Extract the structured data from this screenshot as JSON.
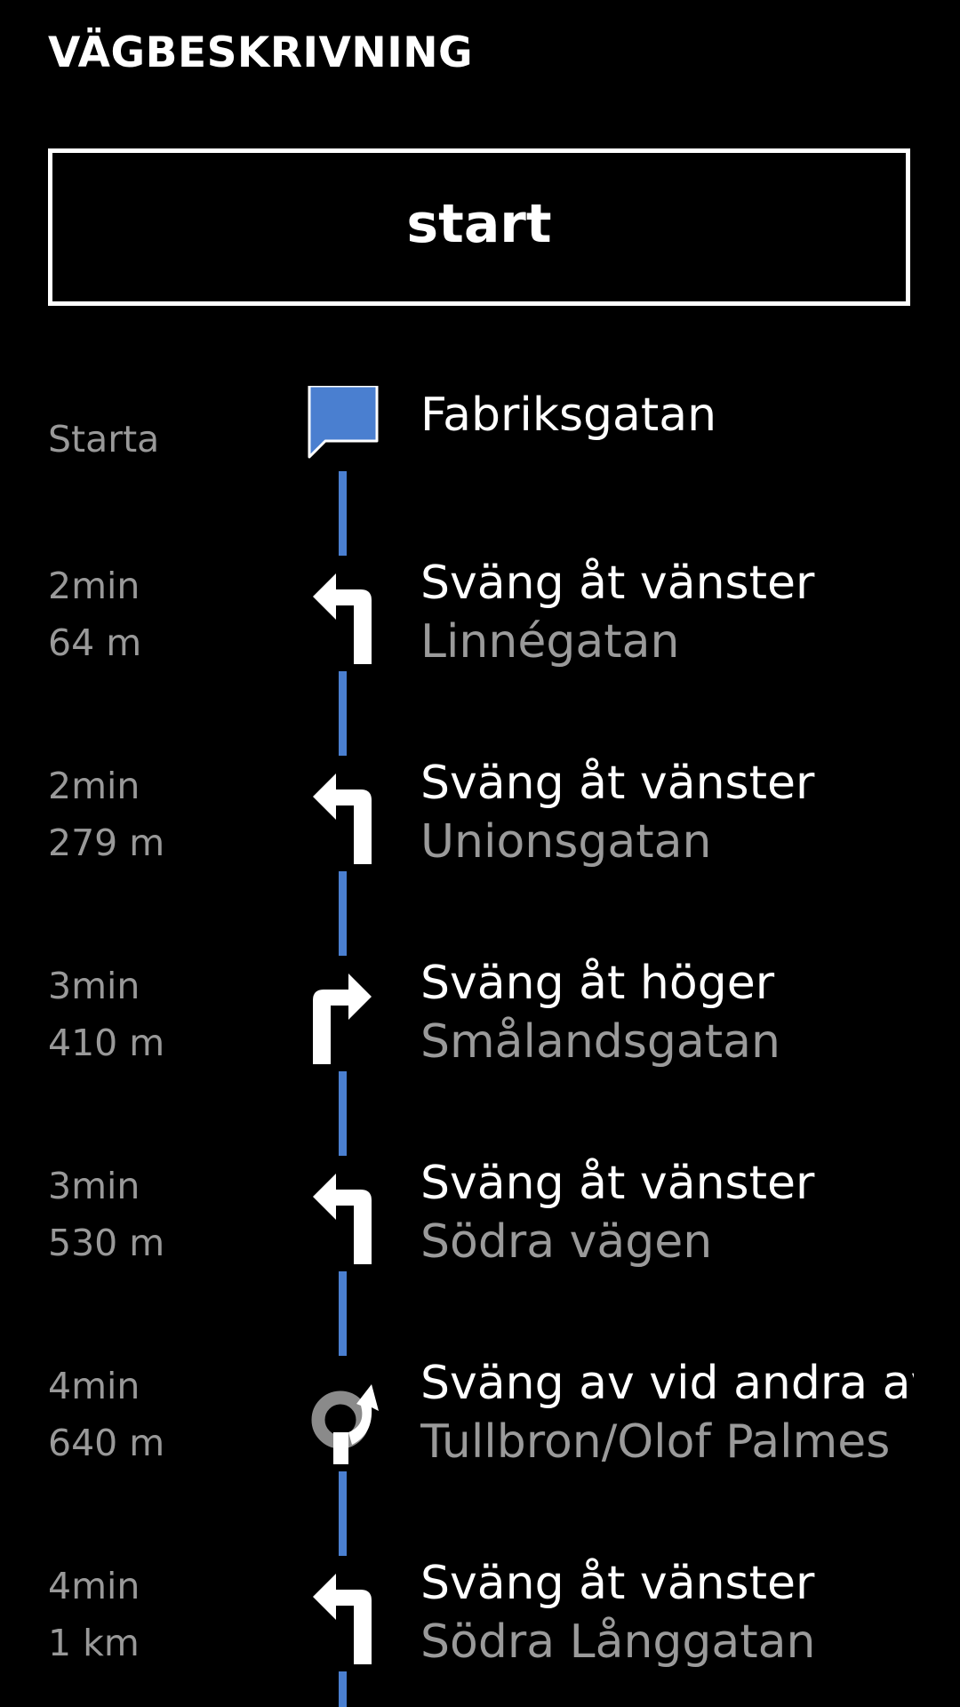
{
  "header": {
    "title": "VÄGBESKRIVNING"
  },
  "start_button": {
    "label": "start"
  },
  "colors": {
    "route": "#4a7fd0",
    "secondary_text": "#999999"
  },
  "start_step": {
    "label": "Starta",
    "street": "Fabriksgatan",
    "icon": "flag-icon"
  },
  "steps": [
    {
      "time": "2min",
      "distance": "64 m",
      "instruction": "Sväng åt vänster",
      "street": "Linnégatan",
      "icon": "turn-left-icon"
    },
    {
      "time": "2min",
      "distance": "279 m",
      "instruction": "Sväng åt vänster",
      "street": "Unionsgatan",
      "icon": "turn-left-icon"
    },
    {
      "time": "3min",
      "distance": "410 m",
      "instruction": "Sväng åt höger",
      "street": "Smålandsgatan",
      "icon": "turn-right-icon"
    },
    {
      "time": "3min",
      "distance": "530 m",
      "instruction": "Sväng åt vänster",
      "street": "Södra vägen",
      "icon": "turn-left-icon"
    },
    {
      "time": "4min",
      "distance": "640 m",
      "instruction": "Sväng av vid andra av",
      "street": "Tullbron/Olof Palmes",
      "icon": "roundabout-icon"
    },
    {
      "time": "4min",
      "distance": "1 km",
      "instruction": "Sväng åt vänster",
      "street": "Södra Långgatan",
      "icon": "turn-left-icon"
    }
  ]
}
